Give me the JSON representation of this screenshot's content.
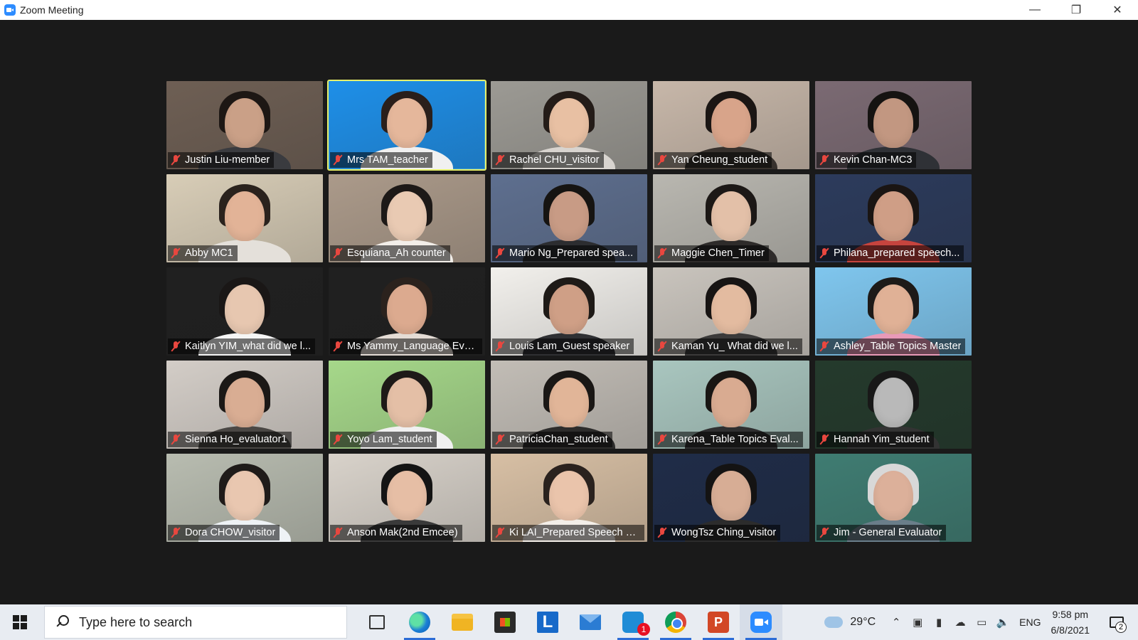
{
  "window": {
    "title": "Zoom Meeting",
    "controls": {
      "minimize": "—",
      "restore": "❐",
      "close": "✕"
    }
  },
  "participants": [
    {
      "name": "Justin Liu-member",
      "bg": "#6e5f54",
      "skin": "#caa087",
      "hair": "#1d1714",
      "body": "#3a3b3f",
      "active": false
    },
    {
      "name": "Mrs TAM_teacher",
      "bg": "#1e8fe8",
      "skin": "#e5b79b",
      "hair": "#2a1f1b",
      "body": "#f0f0f0",
      "active": true
    },
    {
      "name": "Rachel CHU_visitor",
      "bg": "#9c9a94",
      "skin": "#e8c0a3",
      "hair": "#241c18",
      "body": "#d8d4cf",
      "active": false
    },
    {
      "name": "Yan Cheung_student",
      "bg": "#c7b7a9",
      "skin": "#d8a48a",
      "hair": "#1b1614",
      "body": "#37312d",
      "active": false
    },
    {
      "name": "Kevin Chan-MC3",
      "bg": "#7b6a73",
      "skin": "#c29781",
      "hair": "#151311",
      "body": "#2f3136",
      "active": false
    },
    {
      "name": "Abby MC1",
      "bg": "#d8cdb7",
      "skin": "#e2b397",
      "hair": "#2a221d",
      "body": "#e4e0da",
      "active": false
    },
    {
      "name": "Esquiana_Ah counter",
      "bg": "#ab9a8a",
      "skin": "#e9cab3",
      "hair": "#1d1917",
      "body": "#f2eee9",
      "active": false
    },
    {
      "name": "Mario Ng_Prepared spea...",
      "bg": "#5e6f8f",
      "skin": "#c89b85",
      "hair": "#161412",
      "body": "#2c2d30",
      "active": false
    },
    {
      "name": "Maggie Chen_Timer",
      "bg": "#b9b7b0",
      "skin": "#e3c0a8",
      "hair": "#1c1816",
      "body": "#2e2b2a",
      "active": false
    },
    {
      "name": "Philana_prepared speech...",
      "bg": "#2c3b5c",
      "skin": "#cf9e86",
      "hair": "#1a1513",
      "body": "#c6443e",
      "active": false
    },
    {
      "name": "Kaitlyn YIM_what did we l...",
      "bg": "#202020",
      "skin": "#e7c7b0",
      "hair": "#1a1716",
      "body": "#f5f5f5",
      "active": false
    },
    {
      "name": "Ms Yammy_Language Eva...",
      "bg": "#202020",
      "skin": "#dcaa8f",
      "hair": "#2b221d",
      "body": "#e4dcd5",
      "active": false
    },
    {
      "name": "Louis Lam_Guest speaker",
      "bg": "#f2f0ec",
      "skin": "#cf9f86",
      "hair": "#1e1a17",
      "body": "#2f3033",
      "active": false
    },
    {
      "name": "Kaman Yu_ What did we l...",
      "bg": "#c9c4bd",
      "skin": "#e3bba0",
      "hair": "#171413",
      "body": "#3b3a3a",
      "active": false
    },
    {
      "name": "Ashley_Table Topics Master",
      "bg": "#7fc6ee",
      "skin": "#e0b196",
      "hair": "#1d1a18",
      "body": "#e89ab8",
      "active": false
    },
    {
      "name": "Sienna Ho_evaluator1",
      "bg": "#d3cdc7",
      "skin": "#d9ad93",
      "hair": "#1b1816",
      "body": "#4a4744",
      "active": false
    },
    {
      "name": "Yoyo Lam_student",
      "bg": "#a6d88a",
      "skin": "#e4bfa6",
      "hair": "#1e1a18",
      "body": "#f0f0f0",
      "active": false
    },
    {
      "name": "PatriciaChan_student",
      "bg": "#c2bdb6",
      "skin": "#e1b598",
      "hair": "#1a1715",
      "body": "#2d2c2b",
      "active": false
    },
    {
      "name": "Karena_Table Topics Eval...",
      "bg": "#a9c6bf",
      "skin": "#d9ab91",
      "hair": "#191614",
      "body": "#2f2f30",
      "active": false
    },
    {
      "name": "Hannah Yim_student",
      "bg": "#243a2c",
      "skin": "#b9b9b9",
      "hair": "#181818",
      "body": "#333333",
      "active": false
    },
    {
      "name": "Dora CHOW_visitor",
      "bg": "#b8bcb0",
      "skin": "#e9c7b0",
      "hair": "#1f1b19",
      "body": "#eef2f5",
      "active": false
    },
    {
      "name": "Anson Mak(2nd Emcee)",
      "bg": "#d8d2ca",
      "skin": "#e6bea5",
      "hair": "#141414",
      "body": "#3a3a3a",
      "active": false
    },
    {
      "name": "Ki LAI_Prepared Speech E...",
      "bg": "#d7bfa4",
      "skin": "#eac4ab",
      "hair": "#2a221e",
      "body": "#f3eee8",
      "active": false
    },
    {
      "name": "WongTsz Ching_visitor",
      "bg": "#1f2c48",
      "skin": "#d7ad95",
      "hair": "#141313",
      "body": "#2c2c2c",
      "active": false
    },
    {
      "name": "Jim - General Evaluator",
      "bg": "#3f7c72",
      "skin": "#dcb09a",
      "hair": "#d8d8d8",
      "body": "#6a7e8a",
      "active": false
    }
  ],
  "taskbar": {
    "search_placeholder": "Type here to search",
    "apps": [
      {
        "name": "task-view-icon",
        "running": false
      },
      {
        "name": "edge-icon",
        "running": true
      },
      {
        "name": "file-explorer-icon",
        "running": false
      },
      {
        "name": "store-icon",
        "running": false
      },
      {
        "name": "l-app-icon",
        "running": false,
        "letter": "L"
      },
      {
        "name": "mail-icon",
        "running": false
      },
      {
        "name": "chat-icon",
        "running": true,
        "badge": "1"
      },
      {
        "name": "chrome-icon",
        "running": true
      },
      {
        "name": "powerpoint-icon",
        "running": true,
        "letter": "P"
      },
      {
        "name": "zoom-icon",
        "running": true
      }
    ],
    "weather": {
      "temp": "29°C"
    },
    "language": "ENG",
    "time": "9:58 pm",
    "date": "6/8/2021",
    "notifications": "2"
  }
}
